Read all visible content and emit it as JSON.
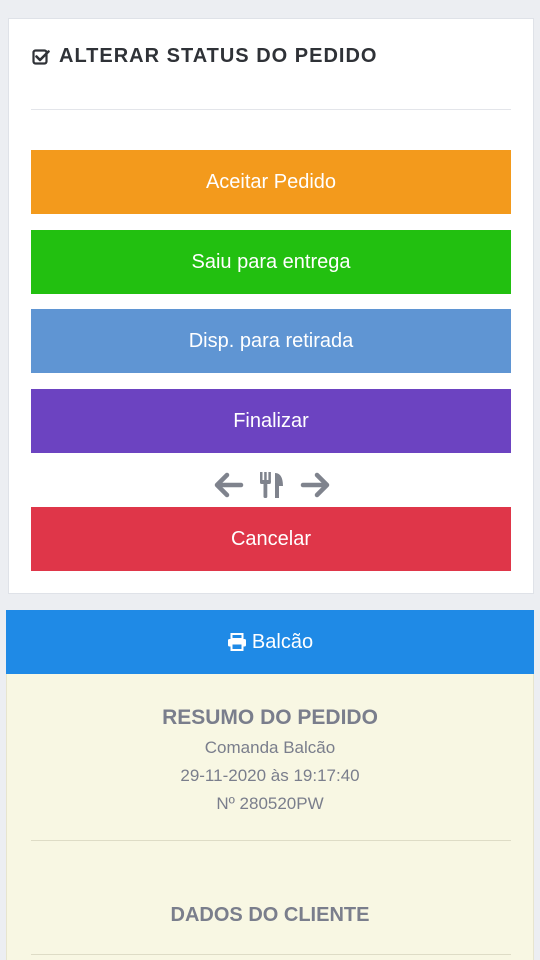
{
  "status_card": {
    "title": "ALTERAR STATUS DO PEDIDO",
    "buttons": {
      "accept": "Aceitar Pedido",
      "delivery": "Saiu para entrega",
      "pickup": "Disp. para retirada",
      "finish": "Finalizar",
      "cancel": "Cancelar"
    },
    "nav_icons": [
      "arrow-left-icon",
      "utensils-icon",
      "arrow-right-icon"
    ]
  },
  "print_bar": {
    "icon": "print-icon",
    "label": "Balcão"
  },
  "summary": {
    "title": "RESUMO DO PEDIDO",
    "order_type": "Comanda Balcão",
    "datetime": "29-11-2020 às 19:17:40",
    "order_number": "Nº 280520PW",
    "client_section_title": "DADOS DO CLIENTE"
  },
  "colors": {
    "accept": "#f39a1c",
    "delivery": "#22c010",
    "pickup": "#5f95d3",
    "finish": "#6c43c1",
    "cancel": "#df3649",
    "print_bar": "#1f8ae6",
    "summary_bg": "#f8f7e3"
  }
}
